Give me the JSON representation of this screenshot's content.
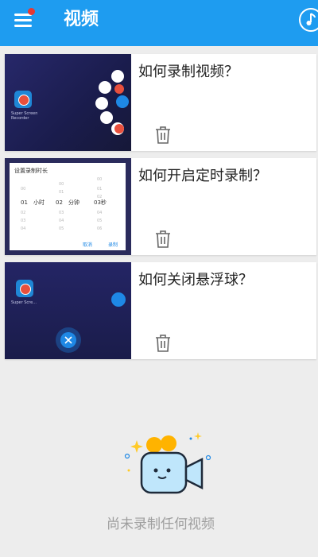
{
  "appbar": {
    "title": "视频"
  },
  "cards": [
    {
      "title": "如何录制视频？",
      "thumb_label": "Super Screen Recorder"
    },
    {
      "title": "如何开启定时录制？",
      "dialog": {
        "title": "设置录制时长",
        "hours": "01",
        "hours_unit": "小时",
        "minutes": "02",
        "minutes_unit": "分钟",
        "seconds": "03秒",
        "cancel": "取消",
        "confirm": "录制"
      }
    },
    {
      "title": "如何关闭悬浮球？",
      "thumb_label": "Super Scre..."
    }
  ],
  "empty_state": {
    "text": "尚未录制任何视频"
  },
  "colors": {
    "appbar": "#1e9cf0",
    "background": "#ededed",
    "accent": "#1e88e5"
  }
}
